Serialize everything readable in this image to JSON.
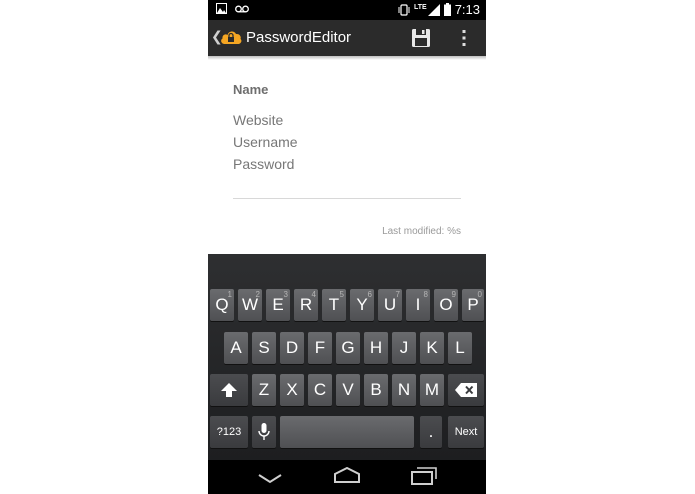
{
  "status_bar": {
    "time": "7:13",
    "network": "LTE",
    "icons": [
      "image-notification-icon",
      "voicemail-icon",
      "vibrate-icon",
      "signal-icon",
      "battery-icon"
    ]
  },
  "action_bar": {
    "title": "PasswordEditor",
    "icons": [
      "back-chevron-icon",
      "app-cloud-lock-icon",
      "save-icon",
      "overflow-menu-icon"
    ]
  },
  "form": {
    "name_label": "Name",
    "website_placeholder": "Website",
    "username_placeholder": "Username",
    "password_placeholder": "Password",
    "last_modified": "Last modified: %s"
  },
  "keyboard": {
    "row1": [
      {
        "label": "Q",
        "hint": "1"
      },
      {
        "label": "W",
        "hint": "2"
      },
      {
        "label": "E",
        "hint": "3"
      },
      {
        "label": "R",
        "hint": "4"
      },
      {
        "label": "T",
        "hint": "5"
      },
      {
        "label": "Y",
        "hint": "6"
      },
      {
        "label": "U",
        "hint": "7"
      },
      {
        "label": "I",
        "hint": "8"
      },
      {
        "label": "O",
        "hint": "9"
      },
      {
        "label": "P",
        "hint": "0"
      }
    ],
    "row2": [
      "A",
      "S",
      "D",
      "F",
      "G",
      "H",
      "J",
      "K",
      "L"
    ],
    "row3": [
      "Z",
      "X",
      "C",
      "V",
      "B",
      "N",
      "M"
    ],
    "symbols_key": "?123",
    "period_key": ".",
    "next_key": "Next",
    "icons": [
      "shift-icon",
      "backspace-icon",
      "microphone-icon"
    ]
  },
  "nav_bar": {
    "icons": [
      "back-icon",
      "home-icon",
      "recent-apps-icon"
    ]
  },
  "colors": {
    "status_bar": "#000000",
    "action_bar": "#2b2b2b",
    "accent": "#f5a623",
    "keyboard_bg": "#262729",
    "key": "#5c5d60"
  }
}
